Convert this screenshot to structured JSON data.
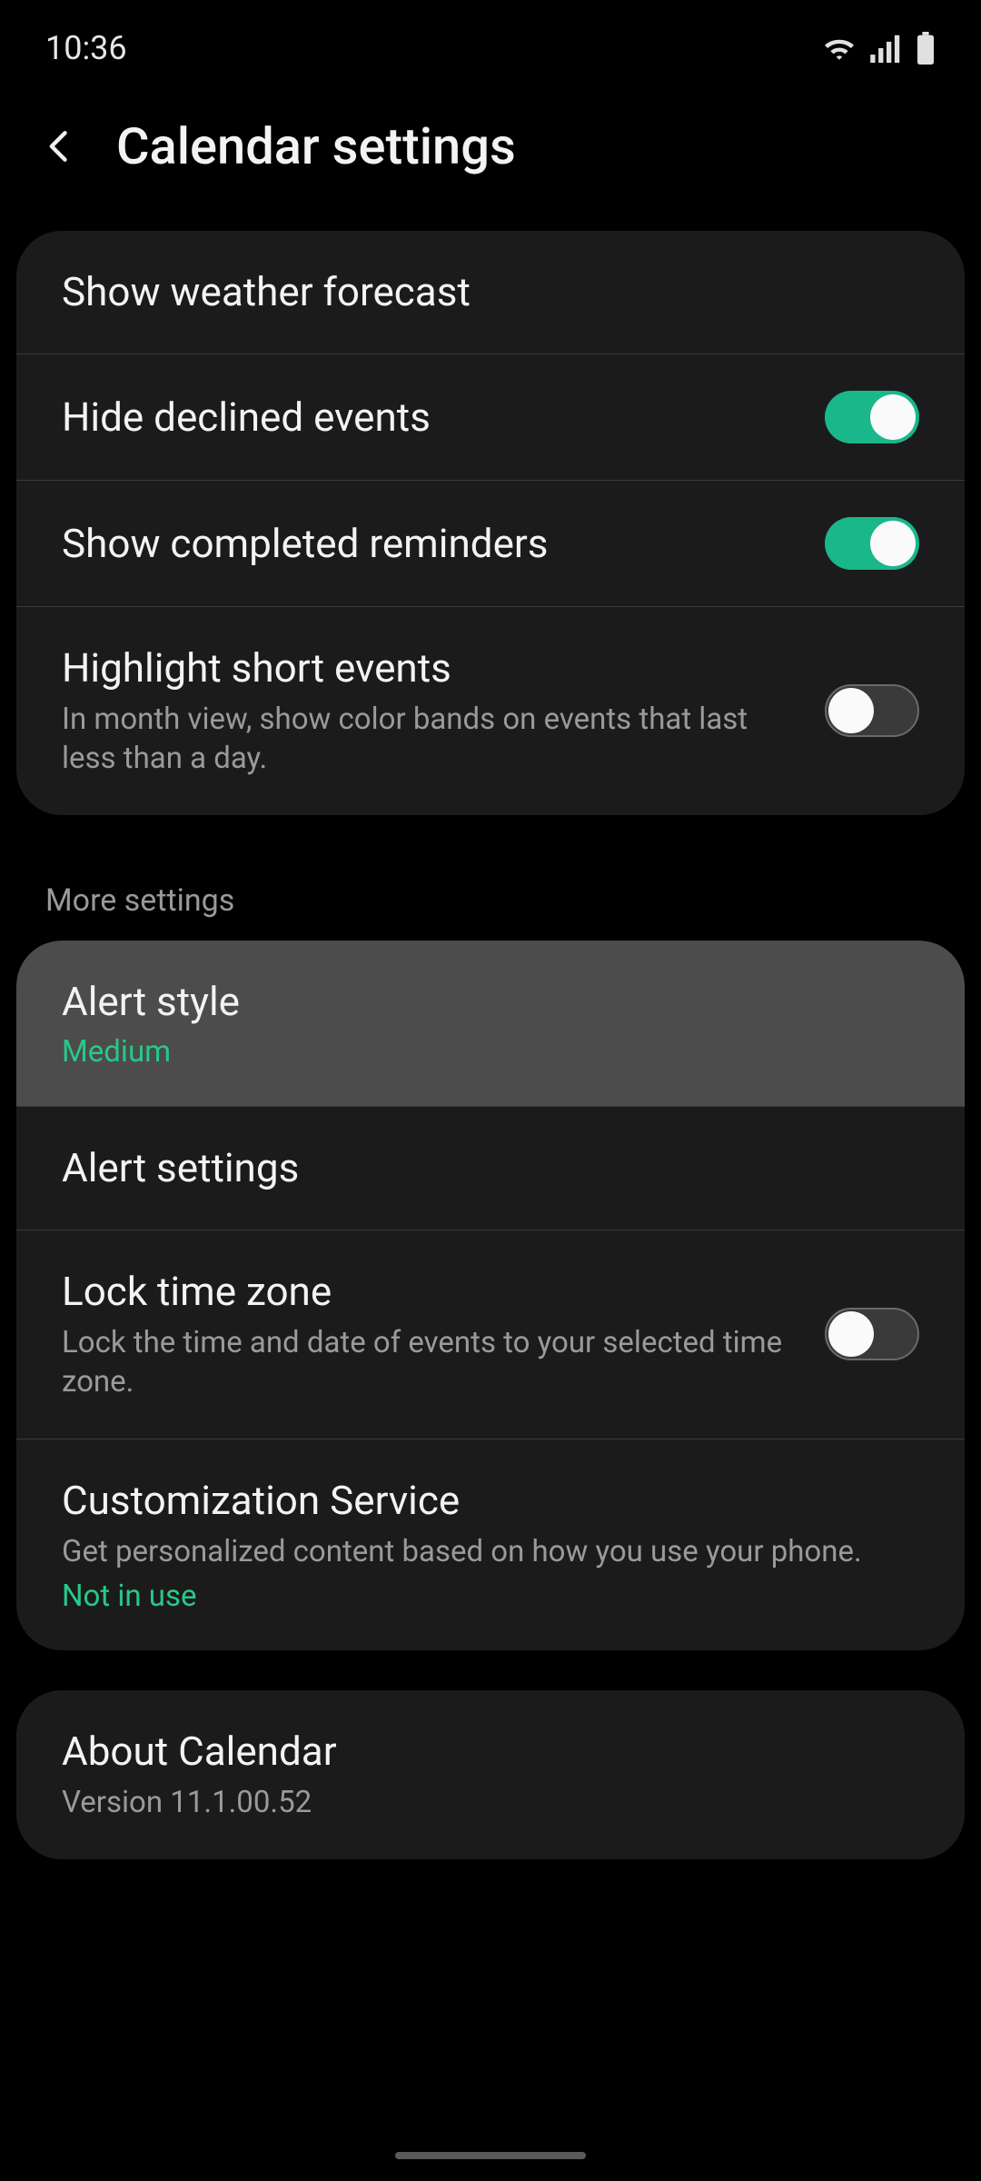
{
  "status": {
    "time": "10:36"
  },
  "header": {
    "title": "Calendar settings"
  },
  "group1": {
    "weather": {
      "title": "Show weather forecast"
    },
    "declined": {
      "title": "Hide declined events",
      "on": true
    },
    "completed": {
      "title": "Show completed reminders",
      "on": true
    },
    "highlight": {
      "title": "Highlight short events",
      "sub": "In month view, show color bands on events that last less than a day.",
      "on": false
    }
  },
  "more_label": "More settings",
  "group2": {
    "alert_style": {
      "title": "Alert style",
      "status": "Medium"
    },
    "alert_settings": {
      "title": "Alert settings"
    },
    "lock_tz": {
      "title": "Lock time zone",
      "sub": "Lock the time and date of events to your selected time zone.",
      "on": false
    },
    "custom": {
      "title": "Customization Service",
      "sub": "Get personalized content based on how you use your phone.",
      "status": "Not in use"
    }
  },
  "group3": {
    "about": {
      "title": "About Calendar",
      "sub": "Version 11.1.00.52"
    }
  }
}
